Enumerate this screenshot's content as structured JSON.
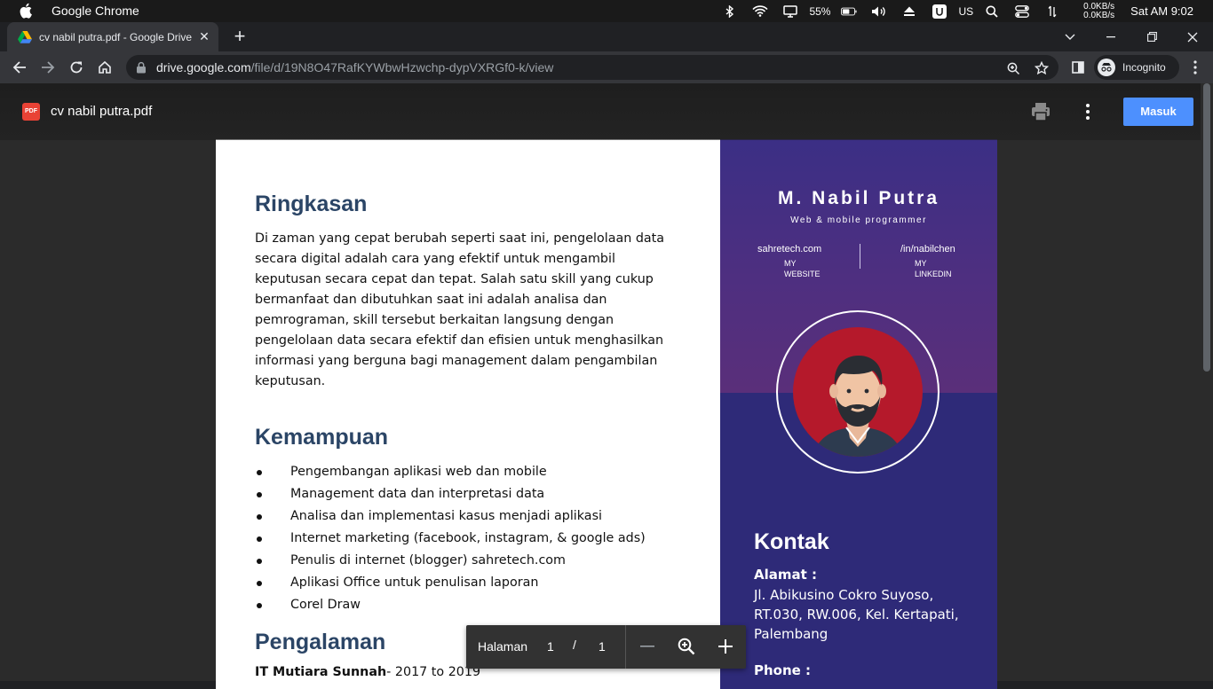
{
  "menubar": {
    "app_name": "Google Chrome",
    "battery": "55%",
    "input_source": "US",
    "net_up": "0.0KB/s",
    "net_down": "0.0KB/s",
    "clock": "Sat AM 9:02"
  },
  "tab": {
    "title": "cv nabil putra.pdf - Google Drive"
  },
  "omnibox": {
    "host": "drive.google.com",
    "path": "/file/d/19N8O47RafKYWbwHzwchp-dypVXRGf0-k/view"
  },
  "profile": {
    "label": "Incognito"
  },
  "viewer": {
    "file_badge": "PDF",
    "doc_title": "cv nabil putra.pdf",
    "signin_label": "Masuk"
  },
  "cv": {
    "summary_heading": "Ringkasan",
    "summary_text": "Di zaman yang cepat berubah seperti saat ini, pengelolaan data secara digital adalah cara yang efektif untuk mengambil keputusan secara cepat dan tepat. Salah satu skill yang cukup bermanfaat dan dibutuhkan saat ini adalah analisa dan pemrograman, skill tersebut berkaitan langsung dengan pengelolaan data secara efektif dan efisien untuk menghasilkan informasi yang berguna bagi management dalam pengambilan keputusan.",
    "skills_heading": "Kemampuan",
    "skills": [
      "Pengembangan aplikasi web dan mobile",
      "Management data dan interpretasi data",
      "Analisa dan implementasi kasus menjadi aplikasi",
      "Internet marketing (facebook, instagram, & google ads)",
      "Penulis  di internet (blogger) sahretech.com",
      "Aplikasi Office untuk penulisan laporan",
      "Corel Draw"
    ],
    "experience_heading": "Pengalaman",
    "experience_company": "IT Mutiara Sunnah",
    "experience_period": "- 2017 to 2019",
    "name": "M. Nabil Putra",
    "role": "Web & mobile programmer",
    "website": "sahretech.com",
    "website_label_1": "MY",
    "website_label_2": "WEBSITE",
    "linkedin": "/in/nabilchen",
    "linkedin_label_1": "MY",
    "linkedin_label_2": "LINKEDIN",
    "contact_heading": "Kontak",
    "address_label": "Alamat :",
    "address": "Jl. Abikusino  Cokro Suyoso, RT.030, RW.006, Kel. Kertapati, Palembang",
    "phone_label": "Phone :"
  },
  "page_control": {
    "label": "Halaman",
    "current": "1",
    "separator": "/",
    "total": "1"
  },
  "colors": {
    "heading": "#2b4566",
    "sidebar": "#2e2a78",
    "avatar_bg": "#b5192b",
    "signin": "#4d90fe"
  }
}
